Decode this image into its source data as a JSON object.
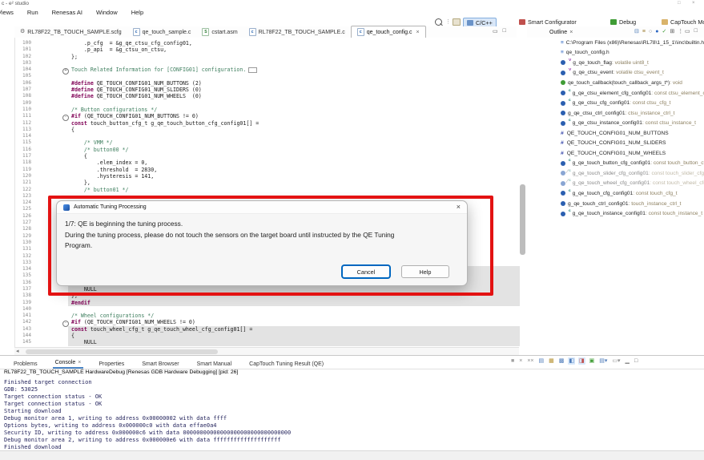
{
  "window": {
    "title_fragment": "c - e² studio",
    "menu": [
      "Views",
      "Run",
      "Renesas AI",
      "Window",
      "Help"
    ]
  },
  "perspective_bar": {
    "items": [
      {
        "label": "C/C++",
        "active": true,
        "icon": "cpp-perspective-icon"
      },
      {
        "label": "Smart Configurator",
        "active": false,
        "icon": "smart-configurator-icon"
      },
      {
        "label": "Debug",
        "active": false,
        "icon": "debug-icon"
      },
      {
        "label": "CapTouch Monitor (QE)",
        "active": false,
        "icon": "captouch-monitor-icon"
      }
    ]
  },
  "editor_tabs": [
    {
      "label": "RL78F22_TB_TOUCH_SAMPLE.scfg",
      "icon": "scfg",
      "active": false
    },
    {
      "label": "qe_touch_sample.c",
      "icon": "c",
      "active": false
    },
    {
      "label": "cstart.asm",
      "icon": "asm",
      "active": false
    },
    {
      "label": "RL78F22_TB_TOUCH_SAMPLE.c",
      "icon": "c",
      "active": false
    },
    {
      "label": "qe_touch_config.c",
      "icon": "c",
      "active": true,
      "closable": true
    }
  ],
  "editor": {
    "lines": [
      {
        "n": 100,
        "t": "    .p_cfg  = &g_qe_ctsu_cfg_config01,"
      },
      {
        "n": 101,
        "t": "    .p_api  = &g_ctsu_on_ctsu,"
      },
      {
        "n": 102,
        "t": "};"
      },
      {
        "n": 103,
        "t": ""
      },
      {
        "n": 104,
        "t": "Touch Related Information for [CONFIG01] configuration.",
        "c": "cm",
        "f": "plus",
        "box": 1
      },
      {
        "n": 105,
        "t": ""
      },
      {
        "n": 106,
        "t": "#define QE_TOUCH_CONFIG01_NUM_BUTTONS (2)"
      },
      {
        "n": 107,
        "t": "#define QE_TOUCH_CONFIG01_NUM_SLIDERS (0)"
      },
      {
        "n": 108,
        "t": "#define QE_TOUCH_CONFIG01_NUM_WHEELS  (0)"
      },
      {
        "n": 109,
        "t": ""
      },
      {
        "n": 110,
        "t": "/* Button configurations */"
      },
      {
        "n": 111,
        "t": "#if (QE_TOUCH_CONFIG01_NUM_BUTTONS != 0)",
        "f": "minus"
      },
      {
        "n": 112,
        "t": "const touch_button_cfg_t g_qe_touch_button_cfg_config01[] ="
      },
      {
        "n": 113,
        "t": "{"
      },
      {
        "n": 114,
        "t": ""
      },
      {
        "n": 115,
        "t": "    /* VMM */"
      },
      {
        "n": 116,
        "t": "    /* button00 */"
      },
      {
        "n": 117,
        "t": "    {"
      },
      {
        "n": 118,
        "t": "        .elem_index = 0,"
      },
      {
        "n": 119,
        "t": "        .threshold  = 2830,"
      },
      {
        "n": 120,
        "t": "        .hysteresis = 141,"
      },
      {
        "n": 121,
        "t": "    },"
      },
      {
        "n": 122,
        "t": "    /* button01 */"
      },
      {
        "n": 123,
        "t": ""
      },
      {
        "n": 124,
        "t": ""
      },
      {
        "n": 125,
        "t": ""
      },
      {
        "n": 126,
        "t": ""
      },
      {
        "n": 127,
        "t": ""
      },
      {
        "n": 128,
        "t": ""
      },
      {
        "n": 129,
        "t": ""
      },
      {
        "n": 130,
        "t": ""
      },
      {
        "n": 131,
        "t": ""
      },
      {
        "n": 132,
        "t": ""
      },
      {
        "n": 133,
        "t": ""
      },
      {
        "n": 134,
        "t": "",
        "g": 1
      },
      {
        "n": 135,
        "t": "",
        "g": 1
      },
      {
        "n": 136,
        "t": "",
        "g": 1
      },
      {
        "n": 137,
        "t": "    NULL",
        "g": 1
      },
      {
        "n": 138,
        "t": "};",
        "g": 1
      },
      {
        "n": 139,
        "t": "#endif",
        "g": 1
      },
      {
        "n": 140,
        "t": ""
      },
      {
        "n": 141,
        "t": "/* Wheel configurations */"
      },
      {
        "n": 142,
        "t": "#if (QE_TOUCH_CONFIG01_NUM_WHEELS != 0)",
        "f": "minus"
      },
      {
        "n": 143,
        "t": "const touch_wheel_cfg_t g_qe_touch_wheel_cfg_config01[] =",
        "g": 1
      },
      {
        "n": 144,
        "t": "{",
        "g": 1
      },
      {
        "n": 145,
        "t": "    NULL",
        "g": 1
      }
    ]
  },
  "outline": {
    "title": "Outline",
    "items": [
      {
        "k": "include",
        "n": "C:\\Program Files (x86)\\Renesas\\RL78\\1_15_1\\\\inc\\builtin.h",
        "t": ""
      },
      {
        "k": "include",
        "n": "qe_touch_config.h",
        "t": ""
      },
      {
        "k": "var",
        "d": "V",
        "n": "g_qe_touch_flag",
        "t": "volatile uint8_t"
      },
      {
        "k": "var",
        "d": "V",
        "n": "g_qe_ctsu_event",
        "t": "volatile ctsu_event_t"
      },
      {
        "k": "func",
        "n": "qe_touch_callback(touch_callback_args_t*)",
        "t": "void"
      },
      {
        "k": "var",
        "d": "c",
        "n": "g_qe_ctsu_element_cfg_config01",
        "t": "const ctsu_element_cfg_t[]"
      },
      {
        "k": "var",
        "d": "c",
        "n": "g_qe_ctsu_cfg_config01",
        "t": "const ctsu_cfg_t"
      },
      {
        "k": "var",
        "n": "g_qe_ctsu_ctrl_config01",
        "t": "ctsu_instance_ctrl_t"
      },
      {
        "k": "var",
        "d": "c",
        "n": "g_qe_ctsu_instance_config01",
        "t": "const ctsu_instance_t"
      },
      {
        "k": "def",
        "n": "QE_TOUCH_CONFIG01_NUM_BUTTONS",
        "t": ""
      },
      {
        "k": "def",
        "n": "QE_TOUCH_CONFIG01_NUM_SLIDERS",
        "t": ""
      },
      {
        "k": "def",
        "n": "QE_TOUCH_CONFIG01_NUM_WHEELS",
        "t": ""
      },
      {
        "k": "var",
        "d": "c",
        "n": "g_qe_touch_button_cfg_config01",
        "t": "const touch_button_cfg_t[]"
      },
      {
        "k": "var",
        "d": "c",
        "n": "g_qe_touch_slider_cfg_config01",
        "t": "const touch_slider_cfg_t[]",
        "gray": 1
      },
      {
        "k": "var",
        "d": "c",
        "n": "g_qe_touch_wheel_cfg_config01",
        "t": "const touch_wheel_cfg_t[]",
        "gray": 1
      },
      {
        "k": "var",
        "d": "c",
        "n": "g_qe_touch_cfg_config01",
        "t": "const touch_cfg_t"
      },
      {
        "k": "var",
        "n": "g_qe_touch_ctrl_config01",
        "t": "touch_instance_ctrl_t"
      },
      {
        "k": "var",
        "d": "c",
        "n": "g_qe_touch_instance_config01",
        "t": "const touch_instance_t"
      }
    ],
    "toolbar_icons": [
      {
        "name": "collapse-all-icon",
        "g": "⊟",
        "c": "#4a7ab5"
      },
      {
        "name": "sort-icon",
        "g": "≡",
        "c": "#9a7b2f"
      },
      {
        "name": "hide-fields-icon",
        "g": "○",
        "c": "#888888"
      },
      {
        "name": "hide-static-members-icon",
        "g": "●",
        "c": "#2b66c2"
      },
      {
        "name": "link-with-editor-icon",
        "g": "✓",
        "c": "#3f9c35"
      },
      {
        "name": "filters-icon",
        "g": "⊞",
        "c": "#555555"
      },
      {
        "name": "view-menu-icon",
        "g": "⋮",
        "c": "#555555"
      }
    ]
  },
  "dialog": {
    "title": "Automatic Tuning Processing",
    "close_glyph": "×",
    "message": {
      "l1": "1/7: QE is beginning the tuning process.",
      "l2": "During the tuning process, please do not touch the sensors on the target board until instructed by the QE Tuning",
      "l3": "Program."
    },
    "buttons": {
      "cancel": "Cancel",
      "help": "Help"
    }
  },
  "console": {
    "tabs": [
      {
        "label": "Problems",
        "selected": false
      },
      {
        "label": "Console",
        "selected": true,
        "closable": true
      },
      {
        "label": "Properties",
        "selected": false
      },
      {
        "label": "Smart Browser",
        "selected": false
      },
      {
        "label": "Smart Manual",
        "selected": false
      },
      {
        "label": "CapTouch Tuning Result (QE)",
        "selected": false
      }
    ],
    "toolbar_icons": [
      {
        "name": "terminate-icon",
        "g": "■",
        "c": "#a0a0a0"
      },
      {
        "name": "remove-launch-icon",
        "g": "×",
        "c": "#8a8a8a"
      },
      {
        "name": "remove-all-launches-icon",
        "g": "××",
        "c": "#8a8a8a"
      },
      {
        "name": "clear-console-icon",
        "g": "▤",
        "c": "#4f7cba"
      },
      {
        "name": "scroll-lock-icon",
        "g": "▦",
        "c": "#b5902f"
      },
      {
        "name": "word-wrap-icon",
        "g": "▩",
        "c": "#4f7cba"
      },
      {
        "name": "show-stdout-icon",
        "g": "◧",
        "c": "#4f7cba",
        "bg": "#d8e8fa"
      },
      {
        "name": "show-stderr-icon",
        "g": "◨",
        "c": "#c0504d",
        "bg": "#d8e8fa"
      },
      {
        "name": "pin-console-icon",
        "g": "▣",
        "c": "#3f9c35"
      },
      {
        "name": "display-console-dropdown-icon",
        "g": "▤▾",
        "c": "#4f7cba"
      },
      {
        "name": "open-console-dropdown-icon",
        "g": "▭▾",
        "c": "#8a8a8a"
      },
      {
        "name": "minimize-icon",
        "g": "▁",
        "c": "#666666"
      },
      {
        "name": "maximize-icon",
        "g": "□",
        "c": "#666666"
      }
    ],
    "launch_line": "RL78F22_TB_TOUCH_SAMPLE HardwareDebug [Renesas GDB Hardware Debugging]  [pid: 26]",
    "lines": [
      "Finished target connection",
      "GDB: 53025",
      "Target connection status - OK",
      "Target connection status - OK",
      "Starting download",
      "Debug monitor area 1, writing to address 0x00000002 with data ffff",
      "Options bytes, writing to address 0x000000c0 with data effae0a4",
      "Security ID, writing to address 0x000000c6 with data 00000000000000000000000000000000",
      "Debug monitor area 2, writing to address 0x000000e6 with data ffffffffffffffffffff",
      "Finished download"
    ]
  },
  "icons": {
    "gear": "⚙",
    "close": "×",
    "minimize": "▭",
    "maximize": "□",
    "scroll_left": "◂",
    "fold_plus": "+",
    "fold_minus": "-",
    "grayed_slash": "∕"
  },
  "colors": {
    "annotation_red": "#e31212",
    "keyword": "#7f0055",
    "comment": "#3f7f5f",
    "inactive_code_bg": "#e3e3e3",
    "focus_blue": "#0067c0",
    "perspective_active_bg": "#d9e7f8"
  }
}
